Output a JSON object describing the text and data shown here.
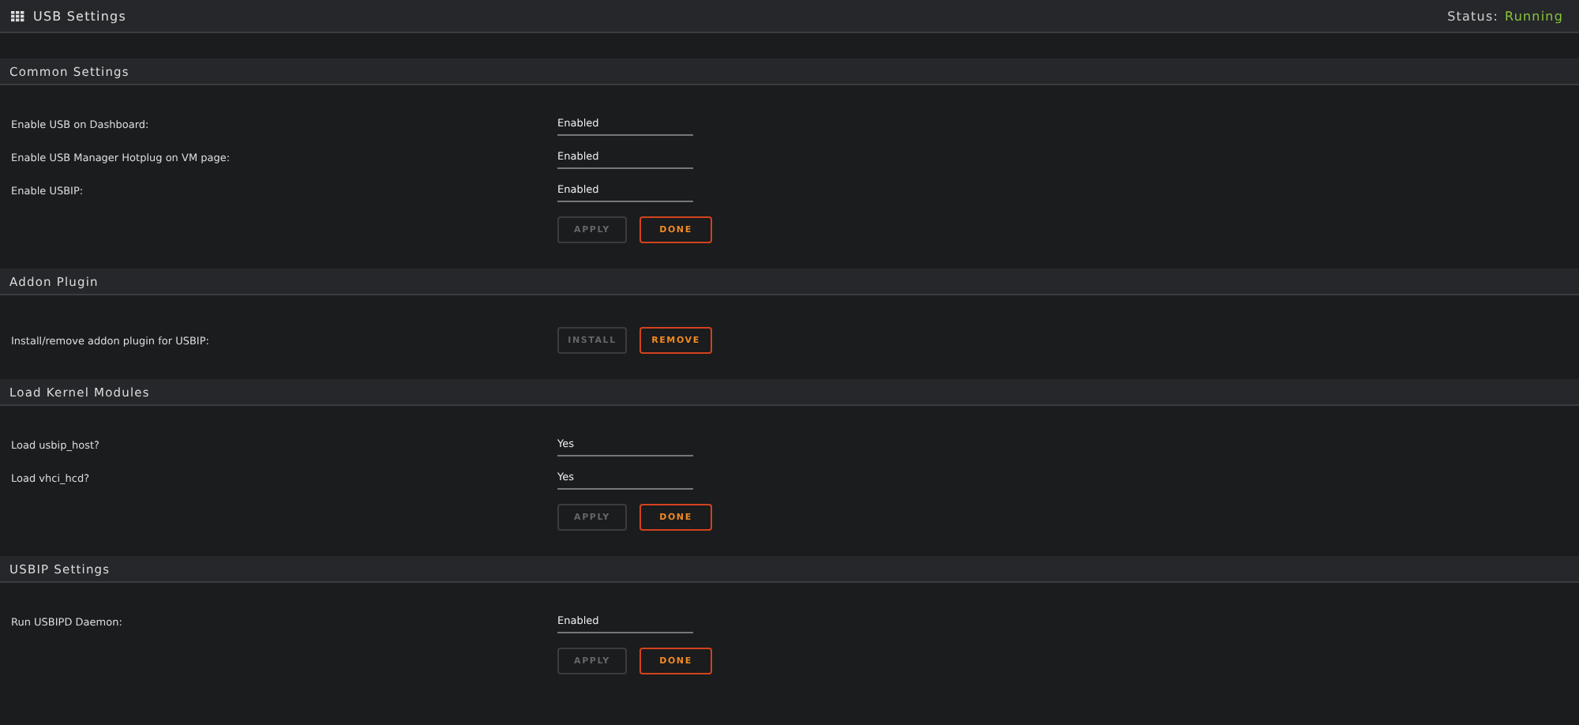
{
  "title_bar": {
    "title": "USB Settings",
    "status_label": "Status:",
    "status_value": "Running"
  },
  "sections": [
    {
      "title": "Common Settings",
      "rows": [
        {
          "kind": "select",
          "label": "Enable USB on Dashboard:",
          "value": "Enabled"
        },
        {
          "kind": "select",
          "label": "Enable USB Manager Hotplug on VM page:",
          "value": "Enabled"
        },
        {
          "kind": "select",
          "label": "Enable USBIP:",
          "value": "Enabled"
        },
        {
          "kind": "buttons",
          "buttons": [
            {
              "label": "APPLY",
              "disabled": true
            },
            {
              "label": "DONE",
              "disabled": false
            }
          ]
        }
      ]
    },
    {
      "title": "Addon Plugin",
      "rows": [
        {
          "kind": "buttons",
          "label": "Install/remove addon plugin for USBIP:",
          "buttons": [
            {
              "label": "INSTALL",
              "disabled": true
            },
            {
              "label": "REMOVE",
              "disabled": false
            }
          ]
        }
      ]
    },
    {
      "title": "Load Kernel Modules",
      "rows": [
        {
          "kind": "select",
          "label": "Load usbip_host?",
          "value": "Yes"
        },
        {
          "kind": "select",
          "label": "Load vhci_hcd?",
          "value": "Yes"
        },
        {
          "kind": "buttons",
          "buttons": [
            {
              "label": "APPLY",
              "disabled": true
            },
            {
              "label": "DONE",
              "disabled": false
            }
          ]
        }
      ]
    },
    {
      "title": "USBIP Settings",
      "rows": [
        {
          "kind": "select",
          "label": "Run USBIPD Daemon:",
          "value": "Enabled"
        },
        {
          "kind": "buttons",
          "buttons": [
            {
              "label": "APPLY",
              "disabled": true
            },
            {
              "label": "DONE",
              "disabled": false
            }
          ]
        }
      ]
    }
  ]
}
